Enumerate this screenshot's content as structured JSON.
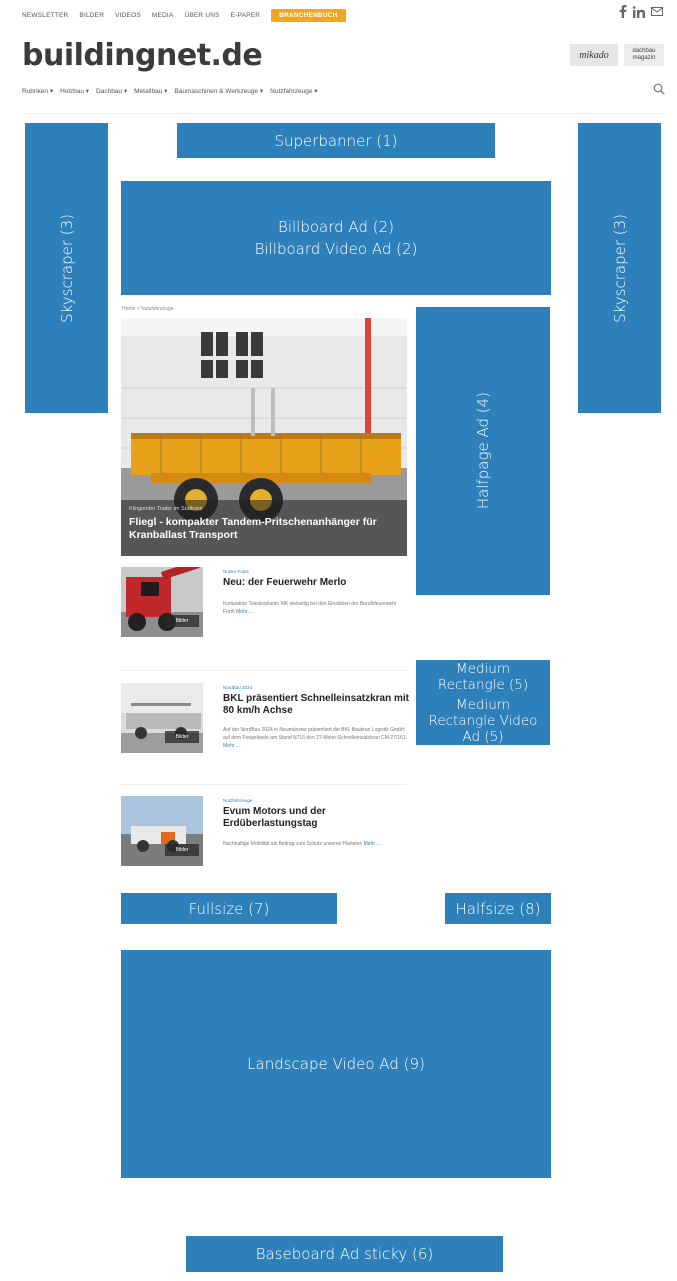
{
  "topnav": {
    "items": [
      "NEWSLETTER",
      "BILDER",
      "VIDEOS",
      "MEDIA",
      "ÜBER UNS",
      "E-PAPER"
    ],
    "cta": "BRANCHENBUCH"
  },
  "social": {
    "icons": [
      "facebook-icon",
      "linkedin-icon",
      "mail-icon"
    ]
  },
  "logo": {
    "text": "buildingnet.de"
  },
  "brands": {
    "b1": "mikado",
    "b2": "dachbau magazin"
  },
  "catnav": {
    "items": [
      "Rubriken ▾",
      "Holzbau ▾",
      "Dachbau ▾",
      "Metallbau ▾",
      "Baumaschinen & Werkzeuge ▾",
      "Nutzfahrzeuge ▾"
    ]
  },
  "ads": {
    "superbanner": "Superbanner (1)",
    "billboard_line1": "Billboard Ad (2)",
    "billboard_line2": "Billboard Video Ad (2)",
    "skyscraper_left": "Skyscraper (3)",
    "skyscraper_right": "Skyscraper (3)",
    "halfpage": "Halfpage Ad (4)",
    "medrect_l1": "Medium",
    "medrect_l2": "Rectangle (5)",
    "medrect_l3": "Medium",
    "medrect_l4": "Rectangle Video",
    "medrect_l5": "Ad (5)",
    "fullsize": "Fullsize (7)",
    "halfsize": "Halfsize (8)",
    "landscape": "Landscape Video Ad (9)",
    "baseboard": "Baseboard Ad sticky (6)"
  },
  "breadcrumb": "Home  >  Nutzfahrzeuge",
  "hero": {
    "tag": "Klingender Trailer im Südkreis",
    "title": "Fliegl - kompakter Tandem-Pritschenanhänger für Kranballast Transport"
  },
  "articles": [
    {
      "meta": "Nutzer Fotos",
      "title": "Neu: der Feuerwehr Merlo",
      "excerpt": "Kompakter Teleskoplader MK vielseitig bei den Einsätzen der Berufsfeuerwehr Fürth",
      "more": "Mehr ...",
      "bild": "Bilder"
    },
    {
      "meta": "NordBau 2024",
      "title": "BKL präsentiert Schnelleinsatzkran mit 80 km/h Achse",
      "excerpt": "Auf der NordBau 2024 in Neumünster präsentiert die BKL Baukran Logistik GmbH auf dem Freigelände am Stand N716 den 27-Meter-Schnelleinsatzkran CM 27/161.",
      "more": "Mehr ...",
      "bild": "Bilder"
    },
    {
      "meta": "Nutzfahrzeuge",
      "title": "Evum Motors und der Erdüberlastungstag",
      "excerpt": "Nachhaltige Mobilität als Beitrag zum Schutz unseres Planeten",
      "more": "Mehr ...",
      "bild": "Bilder"
    }
  ],
  "colors": {
    "ad_blue": "#2e80bb",
    "cta_orange": "#f2a61f"
  }
}
